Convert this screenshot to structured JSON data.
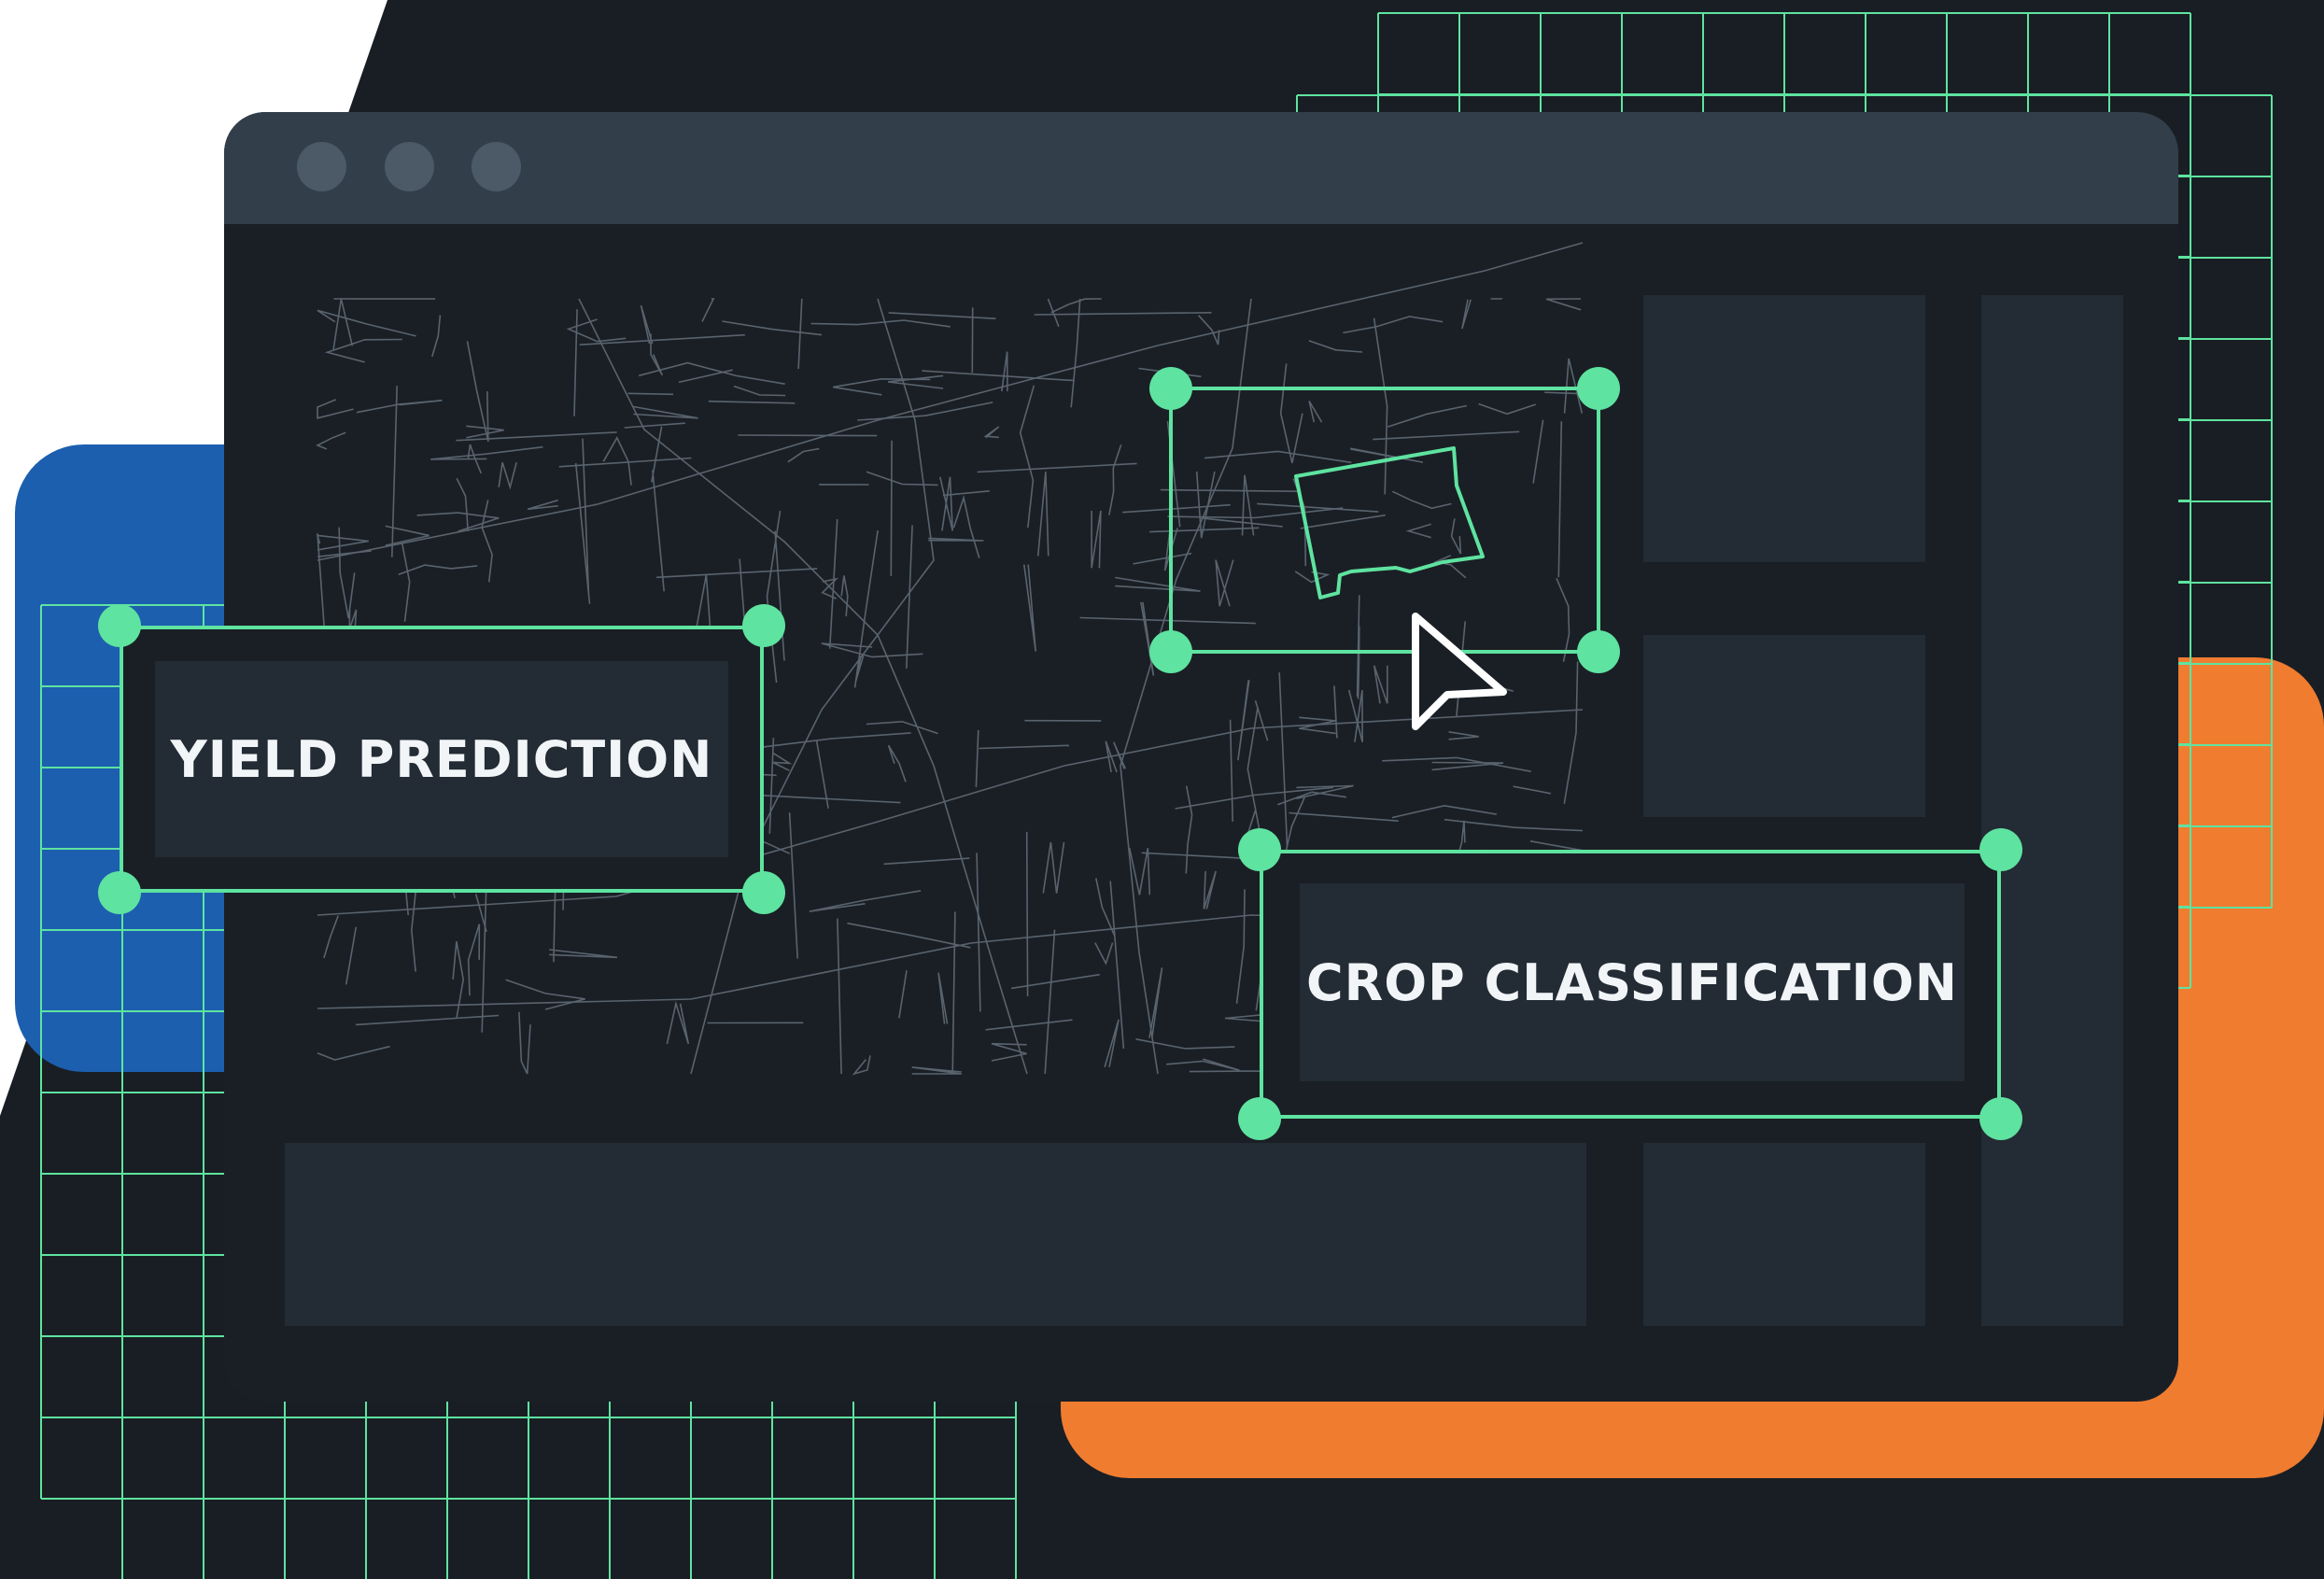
{
  "window": {
    "title_dots": [
      "close-dot",
      "minimize-dot",
      "maximize-dot"
    ]
  },
  "labels": {
    "yield_prediction": "YIELD PREDICTION",
    "crop_classification": "CROP CLASSIFICATION"
  },
  "colors": {
    "background": "#191e24",
    "window": "#1a1f25",
    "titlebar": "#333e4b",
    "panel": "#232b34",
    "accent_green": "#5ee3a0",
    "blue": "#1c5faf",
    "orange": "#f07c30"
  },
  "icons": {
    "cursor": "cursor-arrow-icon"
  }
}
